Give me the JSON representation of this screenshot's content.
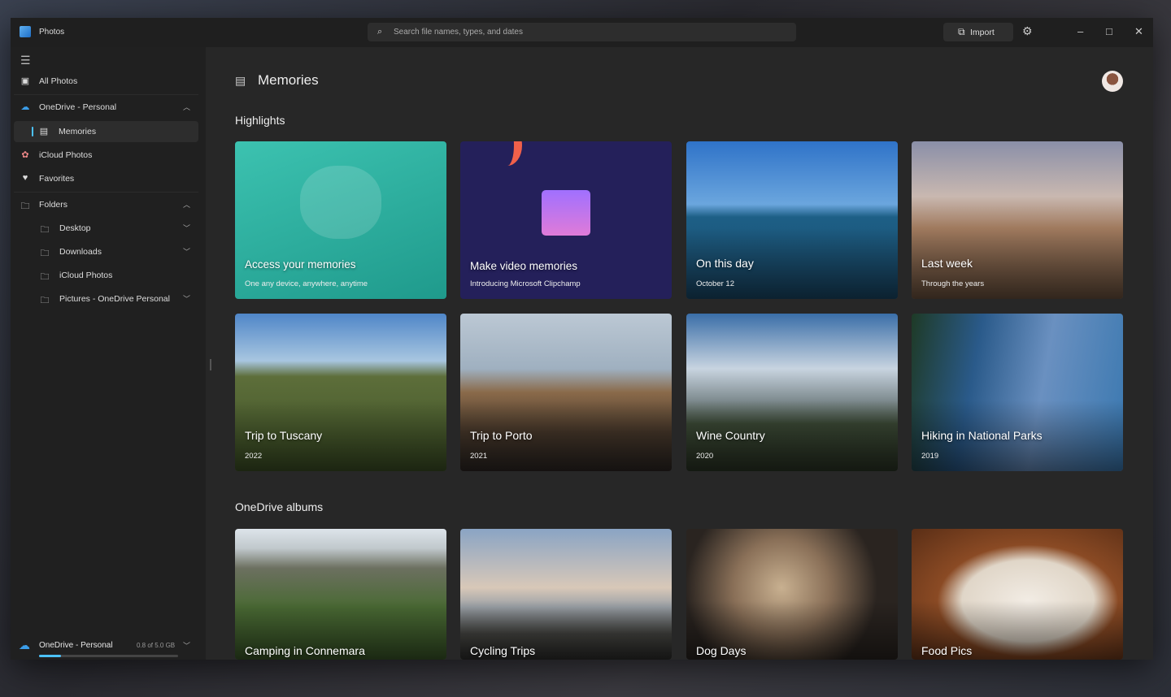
{
  "app": {
    "title": "Photos",
    "search_placeholder": "Search file names, types, and dates",
    "import_label": "Import"
  },
  "sidebar": {
    "items": [
      {
        "label": "All Photos",
        "icon": "photo-icon"
      },
      {
        "label": "OneDrive - Personal",
        "icon": "cloud-icon",
        "expanded": true
      },
      {
        "label": "Memories",
        "icon": "memories-icon",
        "selected": true
      },
      {
        "label": "iCloud Photos",
        "icon": "icloud-icon"
      },
      {
        "label": "Favorites",
        "icon": "heart-icon"
      },
      {
        "label": "Folders",
        "icon": "folder-icon",
        "expanded": true
      },
      {
        "label": "Desktop",
        "icon": "folder-icon"
      },
      {
        "label": "Downloads",
        "icon": "folder-icon"
      },
      {
        "label": "iCloud Photos",
        "icon": "folder-icon"
      },
      {
        "label": "Pictures - OneDrive Personal",
        "icon": "folder-icon"
      }
    ],
    "storage": {
      "label": "OneDrive - Personal",
      "size": "0.8 of 5.0 GB",
      "used_fraction": 0.16
    }
  },
  "main": {
    "title": "Memories",
    "highlights_title": "Highlights",
    "albums_title": "OneDrive albums",
    "highlights": [
      {
        "title": "Access your memories",
        "subtitle": "One any device, anywhere, anytime"
      },
      {
        "title": "Make video memories",
        "subtitle": "Introducing Microsoft Clipchamp"
      },
      {
        "title": "On this day",
        "subtitle": "October 12"
      },
      {
        "title": "Last week",
        "subtitle": "Through the years"
      },
      {
        "title": "Trip to Tuscany",
        "subtitle": "2022"
      },
      {
        "title": "Trip to Porto",
        "subtitle": "2021"
      },
      {
        "title": "Wine Country",
        "subtitle": "2020"
      },
      {
        "title": "Hiking in National Parks",
        "subtitle": "2019"
      }
    ],
    "albums": [
      {
        "title": "Camping in Connemara"
      },
      {
        "title": "Cycling Trips"
      },
      {
        "title": "Dog Days"
      },
      {
        "title": "Food Pics"
      }
    ]
  },
  "colors": {
    "accent": "#4cc2ff"
  }
}
